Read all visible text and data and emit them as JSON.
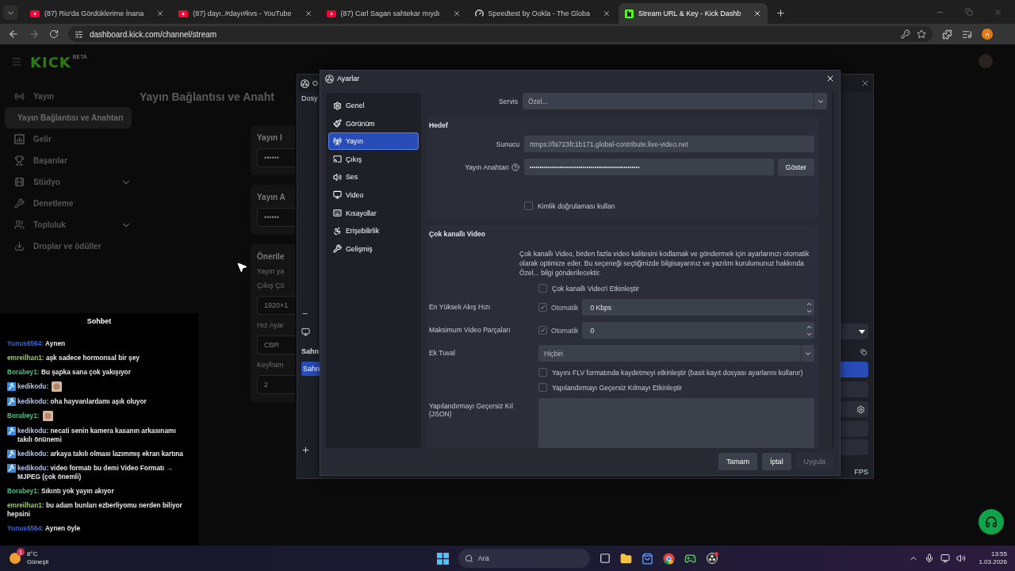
{
  "browser": {
    "tabs": [
      {
        "kind": "youtube",
        "title": "(87) Rio'da Gördüklerime İnana",
        "selected": false
      },
      {
        "kind": "youtube",
        "title": "(87) dayı..#dayı#kvs - YouTube",
        "selected": false
      },
      {
        "kind": "youtube",
        "title": "(87) Carl Sagan sahtekar mıydı",
        "selected": false
      },
      {
        "kind": "speedtest",
        "title": "Speedtest by Ookla - The Globa",
        "selected": false
      },
      {
        "kind": "kick",
        "title": "Stream URL & Key - Kick Dashb",
        "selected": true
      }
    ],
    "url": "dashboard.kick.com/channel/stream",
    "profile_initial": "n"
  },
  "kick": {
    "logo": "KICK",
    "logo_tag": "BETA",
    "nav": [
      {
        "kind": "broadcast",
        "label": "Yayın",
        "children": [
          {
            "label": "Yayın Bağlantısı ve Anahtarı",
            "selected": true
          }
        ]
      },
      {
        "kind": "revenue",
        "label": "Gelir"
      },
      {
        "kind": "trophy",
        "label": "Başarılar"
      },
      {
        "kind": "studio",
        "label": "Stüdyo",
        "expanded": false
      },
      {
        "kind": "wrench",
        "label": "Denetleme"
      },
      {
        "kind": "community",
        "label": "Topluluk",
        "expanded": false
      },
      {
        "kind": "drops",
        "label": "Droplar ve ödüller"
      }
    ],
    "page_title": "Yayın Bağlantısı ve Anaht",
    "cards": [
      {
        "title": "Yayın I",
        "fields": [
          {
            "value": "••••••"
          }
        ]
      },
      {
        "title": "Yayın A",
        "fields": [
          {
            "value": "••••••"
          }
        ]
      },
      {
        "title": "Önerile",
        "subtitle": "Yayın ya",
        "fields": [
          {
            "label": "Çıkış Çö",
            "value": "1920×1"
          },
          {
            "label": "Hız Ayar",
            "value": "CBR"
          },
          {
            "label": "Keyfram",
            "value": "2"
          }
        ]
      }
    ],
    "chat": {
      "title": "Sohbet",
      "messages": [
        {
          "kind": "text",
          "user": "Yunus6564:",
          "color": "#3b64d8",
          "badge": false,
          "text": "Aynen"
        },
        {
          "kind": "text",
          "user": "emreilhan1:",
          "color": "#97cf47",
          "badge": false,
          "text": "aşk sadece hormonsal bir şey"
        },
        {
          "kind": "text",
          "user": "Borabey1:",
          "color": "#45c07c",
          "badge": false,
          "text": "Bu şapka sana çok yakışıyor"
        },
        {
          "kind": "emote",
          "user": "kedikodu:",
          "color": "#b4c6ec",
          "badge": true
        },
        {
          "kind": "text",
          "user": "kedikodu:",
          "color": "#b4c6ec",
          "badge": true,
          "text": "oha hayvanlardamı aşık oluyor"
        },
        {
          "kind": "emote",
          "user": "Borabey1:",
          "color": "#45c07c",
          "badge": false
        },
        {
          "kind": "text",
          "user": "kedikodu:",
          "color": "#b4c6ec",
          "badge": true,
          "text": "necati senin kamera kasanın arkasınamı takılı önünemi"
        },
        {
          "kind": "text",
          "user": "kedikodu:",
          "color": "#b4c6ec",
          "badge": true,
          "text": "arkaya takılı olması lazımmış ekran kartına"
        },
        {
          "kind": "text",
          "user": "kedikodu:",
          "color": "#b4c6ec",
          "badge": true,
          "text": "video formatı bu demi Video Formatı → MJPEG (çok önemli)"
        },
        {
          "kind": "text",
          "user": "Borabey1:",
          "color": "#45c07c",
          "badge": false,
          "text": "Sıkıntı yok yayın akıyor"
        },
        {
          "kind": "text",
          "user": "emreilhan1:",
          "color": "#97cf47",
          "badge": false,
          "text": "bu adam bunları ezberliyomu nerden biliyor hepsini"
        },
        {
          "kind": "text",
          "user": "Yunus6564:",
          "color": "#3b64d8",
          "badge": false,
          "text": "Aynen öyle"
        }
      ]
    }
  },
  "obs": {
    "title": "O",
    "menu": "Dosy",
    "scenes_header": "Sahn",
    "scenes": [
      {
        "label": "Sahn",
        "selected": true
      }
    ],
    "status": "FPS"
  },
  "settings": {
    "title": "Ayarlar",
    "sections": [
      {
        "kind": "general",
        "label": "Genel",
        "selected": false
      },
      {
        "kind": "appearance",
        "label": "Görünüm",
        "selected": false
      },
      {
        "kind": "stream",
        "label": "Yayın",
        "selected": true
      },
      {
        "kind": "output",
        "label": "Çıkış",
        "selected": false
      },
      {
        "kind": "audio",
        "label": "Ses",
        "selected": false
      },
      {
        "kind": "video",
        "label": "Video",
        "selected": false
      },
      {
        "kind": "hotkeys",
        "label": "Kısayollar",
        "selected": false
      },
      {
        "kind": "accessibility",
        "label": "Erişebilirlik",
        "selected": false
      },
      {
        "kind": "advanced",
        "label": "Gelişmiş",
        "selected": false
      }
    ],
    "service": {
      "label": "Servis",
      "value": "Özel..."
    },
    "destination": {
      "title": "Hedef",
      "server": {
        "label": "Sunucu",
        "value": "rtmps://fa723fc1b171.global-contribute.live-video.net"
      },
      "key": {
        "label": "Yayın Anahtarı",
        "value": "••••••••••••••••••••••••••••••••••••••••••••••••••••••••",
        "button": "Göster"
      },
      "auth": {
        "label": "Kimlik doğrulaması kullan",
        "checked": false
      }
    },
    "multitrack": {
      "title": "Çok kanallı Video",
      "description": "Çok kanallı Video, birden fazla video kalitesini kodlamak ve göndermek için ayarlarınızı otomatik olarak optimize eder. Bu seçeneği seçtiğinizde bilgisayarınız ve yazılım kurulumunuz hakkında Özel... bilgi gönderilecektir.",
      "enable": {
        "label": "Çok kanallı Video'i Etkinleştir",
        "checked": false
      },
      "bitrate": {
        "label": "En Yüksek Akış Hızı",
        "auto_label": "Otomatik",
        "auto": true,
        "value": "0 Kbps"
      },
      "tracks": {
        "label": "Maksimum Video Parçaları",
        "auto_label": "Otomatik",
        "auto": true,
        "value": "0"
      },
      "canvas": {
        "label": "Ek Tuval",
        "value": "Hiçbiri"
      },
      "flv": {
        "label": "Yayını FLV formatında kaydetmeyi etkinleştir (basit kayıt dosyası ayarlarını kullanır)",
        "checked": false
      },
      "override": {
        "label": "Yapılandırmayı Geçersiz Kılmayı Etkinleştir",
        "checked": false
      },
      "json": {
        "label": "Yapılandırmayı Geçersiz Kıl (JSON)"
      }
    },
    "buttons": [
      {
        "label": "Tamam",
        "disabled": false
      },
      {
        "label": "İptal",
        "disabled": false
      },
      {
        "label": "Uygula",
        "disabled": true
      }
    ]
  },
  "taskbar": {
    "weather": {
      "badge": "1",
      "temp": "8°C",
      "condition": "Güneşli"
    },
    "search": {
      "placeholder": "Ara"
    },
    "time": "13:55",
    "date": "1.03.2026"
  }
}
